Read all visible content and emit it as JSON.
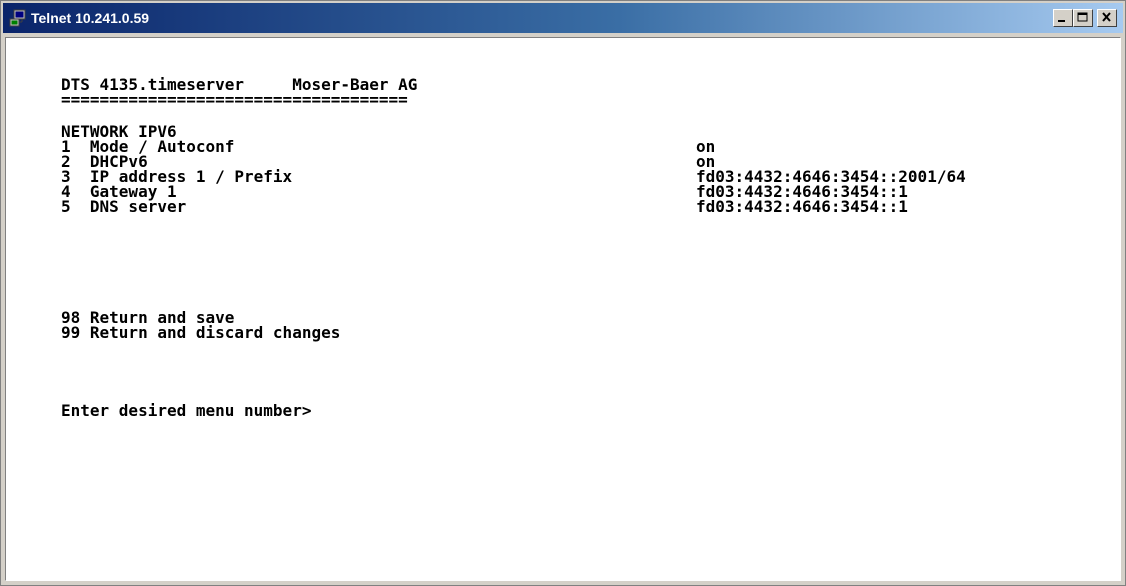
{
  "window": {
    "title": "Telnet 10.241.0.59"
  },
  "terminal": {
    "header": "DTS 4135.timeserver     Moser-Baer AG",
    "separator": "====================================",
    "section_title": "NETWORK IPV6",
    "menu_items": [
      {
        "label": "1  Mode / Autoconf",
        "value": "on"
      },
      {
        "label": "2  DHCPv6",
        "value": "on"
      },
      {
        "label": "3  IP address 1 / Prefix",
        "value": "fd03:4432:4646:3454::2001/64"
      },
      {
        "label": "4  Gateway 1",
        "value": "fd03:4432:4646:3454::1"
      },
      {
        "label": "5  DNS server",
        "value": "fd03:4432:4646:3454::1"
      }
    ],
    "return_save": "98 Return and save",
    "return_discard": "99 Return and discard changes",
    "prompt": "Enter desired menu number>"
  }
}
